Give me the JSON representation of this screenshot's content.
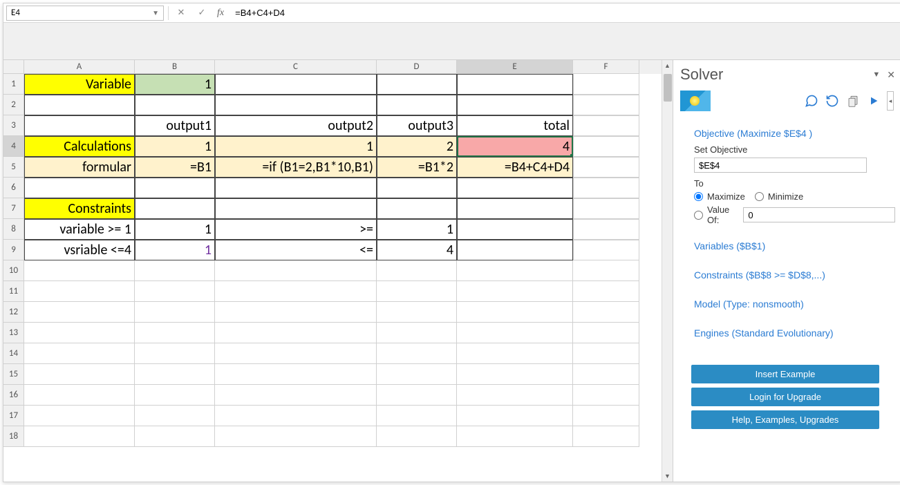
{
  "formula_bar": {
    "cell_ref": "E4",
    "formula": "=B4+C4+D4",
    "fx_label": "fx"
  },
  "columns": [
    "A",
    "B",
    "C",
    "D",
    "E",
    "F"
  ],
  "rows": [
    "1",
    "2",
    "3",
    "4",
    "5",
    "6",
    "7",
    "8",
    "9",
    "10",
    "11",
    "12",
    "13",
    "14",
    "15",
    "16",
    "17",
    "18"
  ],
  "cells": {
    "A1": "Variable",
    "B1": "1",
    "B3": "output1",
    "C3": "output2",
    "D3": "output3",
    "E3": "total",
    "A4": "Calculations",
    "B4": "1",
    "C4": "1",
    "D4": "2",
    "E4": "4",
    "A5": "formular",
    "B5": "=B1",
    "C5": "=if (B1=2,B1*10,B1)",
    "D5": "=B1*2",
    "E5": "=B4+C4+D4",
    "A7": "Constraints",
    "A8": "variable >= 1",
    "B8": "1",
    "C8": ">=",
    "D8": "1",
    "A9": "vsriable <=4",
    "B9": "1",
    "C9": "<=",
    "D9": "4"
  },
  "solver": {
    "title": "Solver",
    "objective_link": "Objective (Maximize $E$4 )",
    "set_objective_label": "Set Objective",
    "set_objective_value": "$E$4",
    "to_label": "To",
    "maximize_label": "Maximize",
    "minimize_label": "Minimize",
    "valueof_label": "Value Of:",
    "valueof_value": "0",
    "variables_link": "Variables ($B$1)",
    "constraints_link": "Constraints ($B$8 >= $D$8,...)",
    "model_link": "Model (Type: nonsmooth)",
    "engines_link": "Engines (Standard Evolutionary)",
    "btn_insert": "Insert Example",
    "btn_login": "Login for Upgrade",
    "btn_help": "Help, Examples, Upgrades"
  }
}
